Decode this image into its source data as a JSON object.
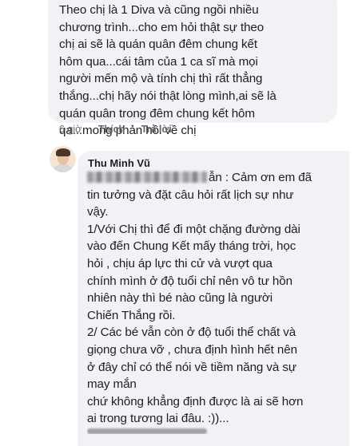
{
  "comment_1": {
    "text": "Theo chị là 1 Diva và cũng ngồi nhiều\nchương trình...cho em hỏi thật sự theo\nchị ai sẽ là quán quân đêm chung kết\nhôm qua...cái tâm của 1 ca sĩ mà mọi\nngười mến mộ và tính chị thì rất thẳng\nthắng...chị hãy nói thật lòng mình,ai sẽ là\nquán quân trong đêm chung kết hôm\nqa...mong phản hồi về chị",
    "time": "6 giờ",
    "like_label": "Thích",
    "reply_label": "Trả lời"
  },
  "comment_2": {
    "author": "Thu Minh Vũ",
    "redacted_suffix": "ẫn",
    "text": " : Cảm ơn em đã\ntin tưởng và đặt câu hỏi rất lịch sự như\nvậy.\n1/Với Chị thì để đi một chặng đường dài\nvào đến Chung Kết mấy tháng trời, học\nhỏi , chịu áp lực thi cử và vượt qua\nchính mình ở độ tuổi chỉ nên vô tư hồn\nnhiên này thì bé nào cũng là người\nChiến Thắng rồi.\n2/  Các bé vẫn còn ở độ tuổi thể chất và\ngiọng chưa vỡ , chưa định hình hết nên\nở đây chỉ có thể nói về tiềm năng và sự\nmay mắn\nchứ không khẳng định được là ai sẽ hơn\nai trong tương lai đâu. :))..."
  }
}
